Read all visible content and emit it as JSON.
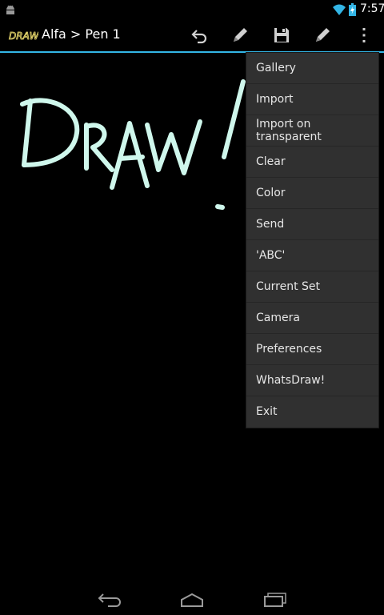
{
  "status_bar": {
    "time": "7:57",
    "icons": [
      "android-icon",
      "wifi-icon",
      "battery-icon"
    ]
  },
  "action_bar": {
    "title": "Alfa > Pen 1",
    "logo_text": "DRAW!",
    "icons": [
      "undo-icon",
      "pencil-icon",
      "save-icon",
      "pencil-icon",
      "overflow-menu-icon"
    ]
  },
  "canvas": {
    "drawing_text": "DRAW!",
    "stroke_color": "#CFF7EC"
  },
  "menu": {
    "items": [
      "Gallery",
      "Import",
      "Import on transparent",
      "Clear",
      "Color",
      "Send",
      "'ABC'",
      "Current Set",
      "Camera",
      "Preferences",
      "WhatsDraw!",
      "Exit"
    ]
  },
  "nav_bar": {
    "icons": [
      "back-icon",
      "home-icon",
      "recent-apps-icon"
    ]
  },
  "colors": {
    "accent": "#33B5E5",
    "menu_bg": "#303030",
    "background": "#000000"
  }
}
